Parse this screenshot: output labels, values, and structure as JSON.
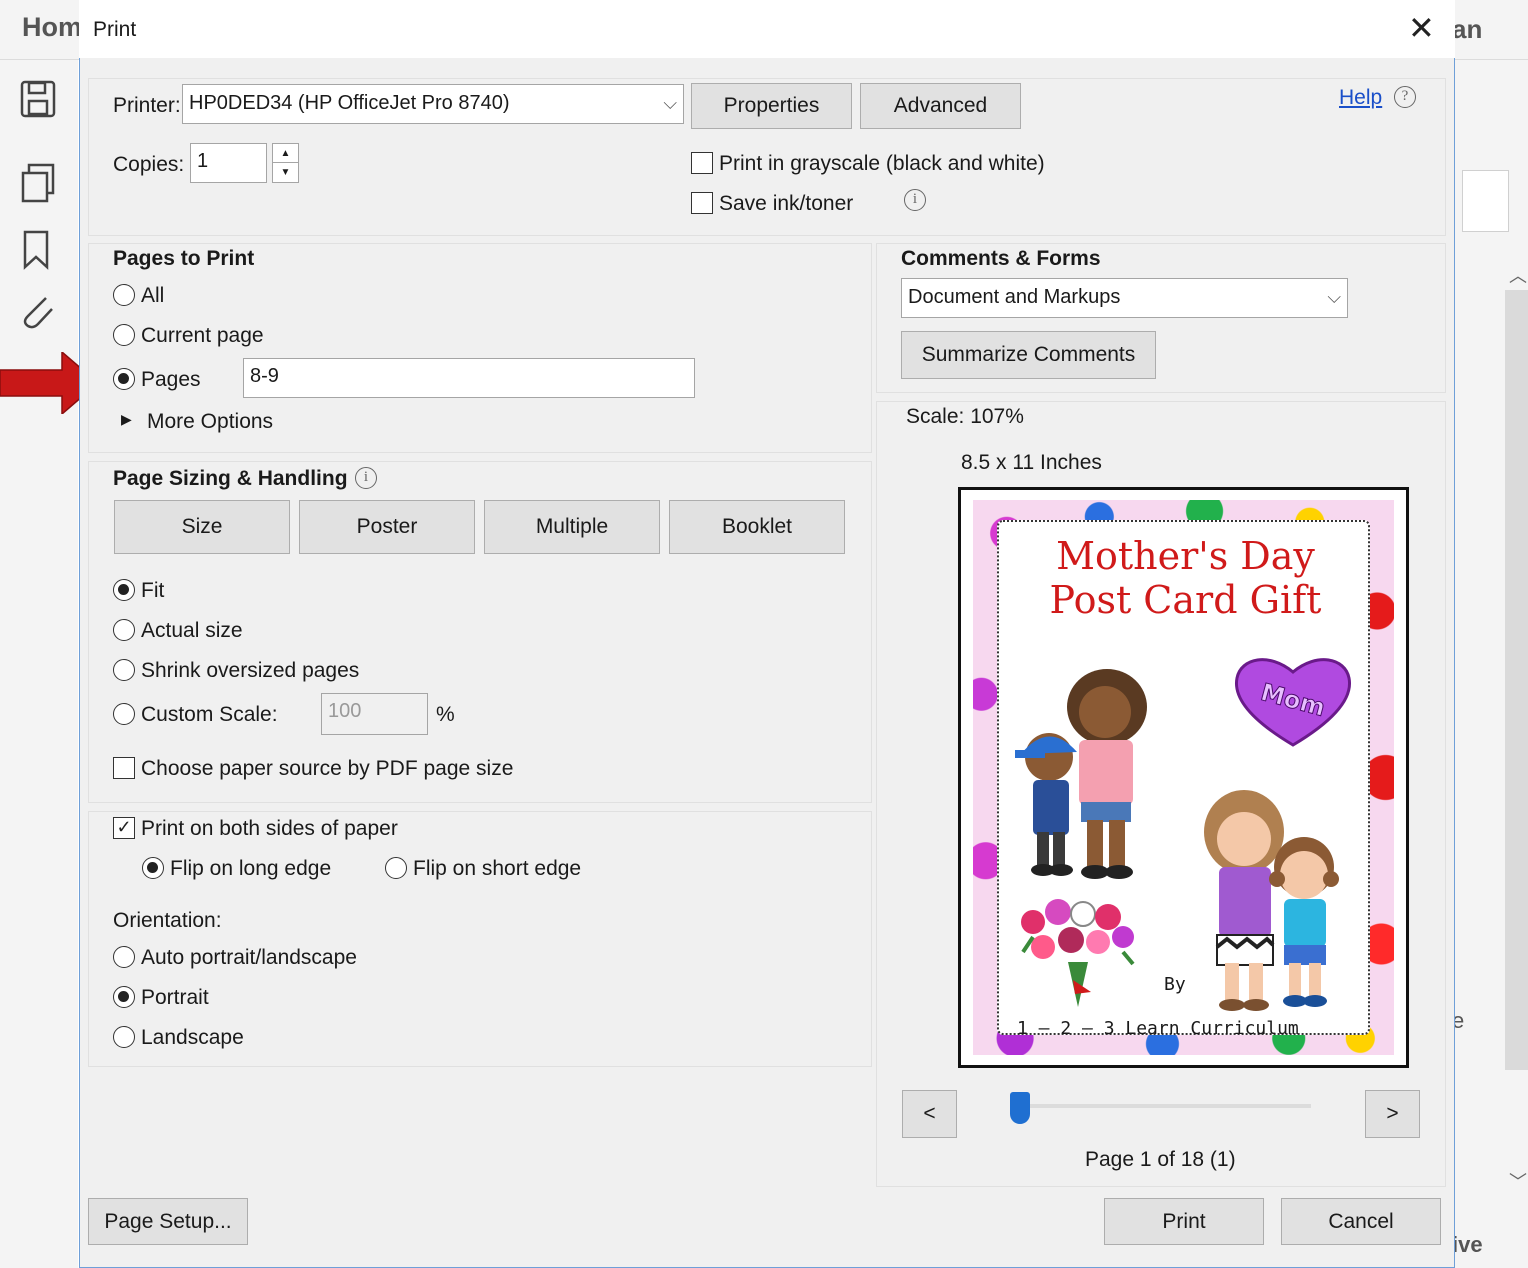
{
  "background_app": {
    "home_tab": "Hom",
    "right_tab": "an",
    "right_snippet_1": "e",
    "right_snippet_2": "ive"
  },
  "dialog": {
    "title": "Print",
    "help_link": "Help",
    "printer": {
      "label": "Printer:",
      "value": "HP0DED34 (HP OfficeJet Pro 8740)",
      "properties_button": "Properties",
      "advanced_button": "Advanced"
    },
    "copies": {
      "label": "Copies:",
      "value": "1"
    },
    "grayscale": {
      "label": "Print in grayscale (black and white)",
      "checked": false
    },
    "save_ink": {
      "label": "Save ink/toner",
      "checked": false
    },
    "pages_to_print": {
      "heading": "Pages to Print",
      "all": "All",
      "current_page": "Current page",
      "pages": "Pages",
      "pages_value": "8-9",
      "selected": "pages",
      "more_options": "More Options"
    },
    "comments_forms": {
      "heading": "Comments & Forms",
      "value": "Document and Markups",
      "summarize_button": "Summarize Comments"
    },
    "page_sizing": {
      "heading": "Page Sizing & Handling",
      "tabs": [
        "Size",
        "Poster",
        "Multiple",
        "Booklet"
      ],
      "fit": "Fit",
      "actual_size": "Actual size",
      "shrink": "Shrink oversized pages",
      "custom_scale": "Custom Scale:",
      "custom_scale_value": "100",
      "percent": "%",
      "paper_source": "Choose paper source by PDF page size",
      "selected": "fit"
    },
    "duplex": {
      "label": "Print on both sides of paper",
      "checked": true,
      "long_edge": "Flip on long edge",
      "short_edge": "Flip on short edge",
      "selected": "long"
    },
    "orientation": {
      "label": "Orientation:",
      "auto": "Auto portrait/landscape",
      "portrait": "Portrait",
      "landscape": "Landscape",
      "selected": "portrait"
    },
    "preview": {
      "scale": "Scale: 107%",
      "paper_size": "8.5 x 11 Inches",
      "card_title_line1": "Mother's Day",
      "card_title_line2": "Post Card Gift",
      "card_heart": "Mom",
      "card_by": "By",
      "card_author": "1 – 2 – 3 Learn Curriculum",
      "prev_button": "<",
      "next_button": ">",
      "page_indicator": "Page 1 of 18 (1)"
    },
    "page_setup_button": "Page Setup...",
    "print_button": "Print",
    "cancel_button": "Cancel"
  },
  "colors": {
    "accent_blue": "#1f6fd1",
    "help_link": "#1a4fc9",
    "card_red": "#d01a1a",
    "arrow_red": "#c81818"
  }
}
